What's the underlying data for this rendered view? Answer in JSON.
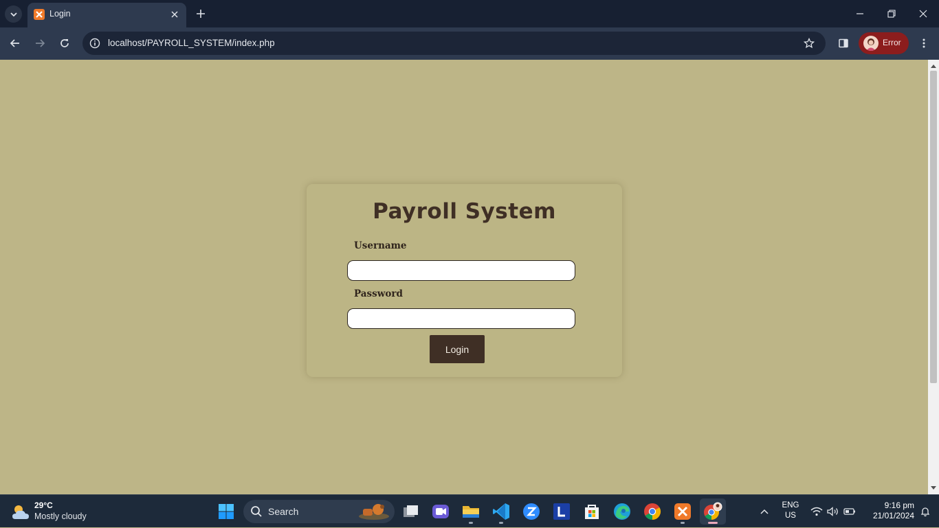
{
  "browser": {
    "tab": {
      "title": "Login"
    },
    "address": {
      "url": "localhost/PAYROLL_SYSTEM/index.php"
    },
    "profile": {
      "label": "Error"
    }
  },
  "page": {
    "title": "Payroll System",
    "username_label": "Username",
    "username_value": "",
    "password_label": "Password",
    "password_value": "",
    "login_label": "Login",
    "colors": {
      "background": "#bdb587",
      "card": "#bcb585",
      "accent": "#3f2f25"
    }
  },
  "taskbar": {
    "weather": {
      "temp": "29°C",
      "condition": "Mostly cloudy"
    },
    "search": {
      "placeholder": "Search"
    },
    "apps": [
      "windows-start-icon",
      "file-manager-icon",
      "meet-icon",
      "file-explorer-icon",
      "vscode-icon",
      "zoom-icon",
      "l-app-icon",
      "microsoft-store-icon",
      "edge-icon",
      "chrome-icon",
      "xampp-icon",
      "chrome-profile-icon"
    ],
    "language": {
      "line1": "ENG",
      "line2": "US"
    },
    "clock": {
      "time": "9:16 pm",
      "date": "21/01/2024"
    }
  }
}
